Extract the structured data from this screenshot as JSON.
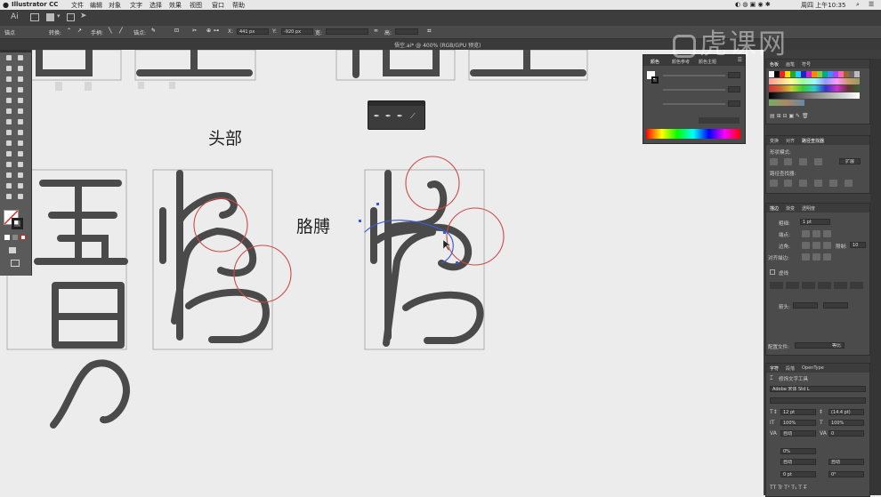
{
  "menubar": {
    "app_name": "Illustrator CC",
    "items": [
      "文件",
      "编辑",
      "对象",
      "文字",
      "选择",
      "效果",
      "视图",
      "窗口",
      "帮助"
    ],
    "clock": "周四 上午10:35"
  },
  "app_bar": {
    "logo": "Ai"
  },
  "control_bar": {
    "mode_label": "锚点",
    "convert_label": "转换:",
    "handle_label": "手柄:",
    "anchor_label": "锚点:",
    "x_value": "441 px",
    "y_value": "-920 px",
    "width_label": "宽:",
    "height_label": "高:"
  },
  "document_tab": {
    "title": "悟空.ai* @ 400% (RGB/GPU 预览)"
  },
  "canvas": {
    "label_head": "头部",
    "label_arm": "胳膊"
  },
  "color_panel": {
    "tabs": [
      "颜色",
      "颜色参考",
      "颜色主题"
    ]
  },
  "swatches_panel": {
    "tabs": [
      "色板",
      "画笔",
      "符号"
    ]
  },
  "pathfinder_panel": {
    "tabs": [
      "变换",
      "对齐",
      "路径查找器"
    ],
    "shape_modes_label": "形状模式:",
    "pathfinder_label": "路径查找器:",
    "expand_label": "扩展"
  },
  "stroke_panel": {
    "tabs": [
      "描边",
      "渐变",
      "透明度"
    ],
    "weight_label": "粗细:",
    "weight_value": "1 pt",
    "cap_label": "端点:",
    "corner_label": "边角:",
    "limit_label": "限制:",
    "limit_value": "10",
    "align_label": "对齐描边:",
    "dashed_label": "虚线",
    "arrow_label": "箭头:",
    "profile_label": "配置文件:",
    "profile_value": "等比"
  },
  "character_panel": {
    "tabs": [
      "字符",
      "段落",
      "OpenType"
    ],
    "touch_tool_label": "修饰文字工具",
    "font_family": "Adobe 宋体 Std L",
    "font_size": "12 pt",
    "leading": "(14.4 pt)",
    "vscale": "100%",
    "hscale": "100%",
    "kerning": "自动",
    "tracking": "0",
    "tsume": "0%",
    "aki_left": "自动",
    "aki_right": "自动",
    "baseline": "0 pt",
    "rotation": "0°"
  },
  "watermark": {
    "text": "虎课网"
  },
  "colors": {
    "accent_red": "#cc4a4a",
    "stroke_gray": "#4a4a4a",
    "ui_dark": "#3e3e3e",
    "selection_blue": "#3b5bd6"
  }
}
